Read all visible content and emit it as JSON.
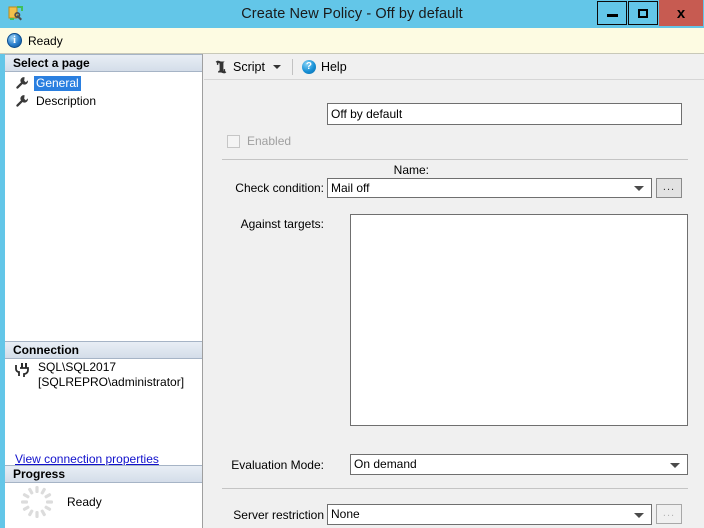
{
  "window": {
    "title": "Create New Policy - Off by default",
    "app_icon": "policy-wrench-icon",
    "minimize_label": "",
    "maximize_label": "",
    "close_label": "x",
    "titlebar_color": "#63c6e8",
    "close_color": "#c75b51"
  },
  "statusbar": {
    "icon": "info-icon",
    "icon_glyph": "i",
    "text": "Ready",
    "background": "#fdfbe2"
  },
  "sidebar": {
    "select_page_header": "Select a page",
    "pages": [
      {
        "label": "General",
        "icon": "wrench-icon",
        "selected": true
      },
      {
        "label": "Description",
        "icon": "wrench-icon",
        "selected": false
      }
    ],
    "connection_header": "Connection",
    "connection": {
      "icon": "server-connection-icon",
      "server": "SQL\\SQL2017",
      "user": "[SQLREPRO\\administrator]",
      "link": "View connection properties"
    },
    "progress_header": "Progress",
    "progress": {
      "icon": "spinner-icon",
      "text": "Ready"
    },
    "selection_color": "#2a7fe0",
    "link_color": "#1111cc"
  },
  "toolbar": {
    "script_label": "Script",
    "script_icon": "script-icon",
    "caret_icon": "chevron-down-icon",
    "help_label": "Help",
    "help_icon": "help-question-icon",
    "help_glyph": "?"
  },
  "form": {
    "name": {
      "label": "Name:",
      "value": "Off by default",
      "placeholder": ""
    },
    "enabled": {
      "label": "Enabled",
      "checked": false,
      "disabled": true
    },
    "check_condition": {
      "label": "Check condition:",
      "value": "Mail off",
      "browse_label": "...",
      "browse_disabled": false
    },
    "against_targets": {
      "label": "Against targets:",
      "value": ""
    },
    "evaluation_mode": {
      "label": "Evaluation Mode:",
      "value": "On demand"
    },
    "server_restriction": {
      "label": "Server restriction",
      "value": "None",
      "browse_label": "...",
      "browse_disabled": true
    }
  }
}
